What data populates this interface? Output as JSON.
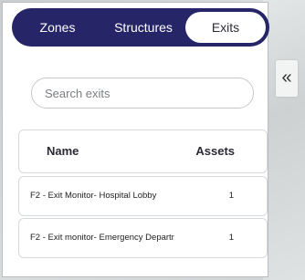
{
  "tabs": [
    {
      "label": "Zones",
      "active": false
    },
    {
      "label": "Structures",
      "active": false
    },
    {
      "label": "Exits",
      "active": true
    }
  ],
  "search": {
    "placeholder": "Search exits",
    "value": ""
  },
  "table": {
    "columns": [
      "Name",
      "Assets"
    ],
    "rows": [
      {
        "name": "F2 - Exit Monitor- Hospital Lobby",
        "assets": "1"
      },
      {
        "name": "F2 - Exit monitor- Emergency Departr",
        "assets": "1"
      }
    ]
  },
  "collapse_button": {
    "icon": "double-chevron-left-icon",
    "glyph": "«"
  },
  "colors": {
    "tab_bar_bg": "#252568",
    "active_tab_bg": "#ffffff",
    "panel_bg": "#ffffff"
  }
}
